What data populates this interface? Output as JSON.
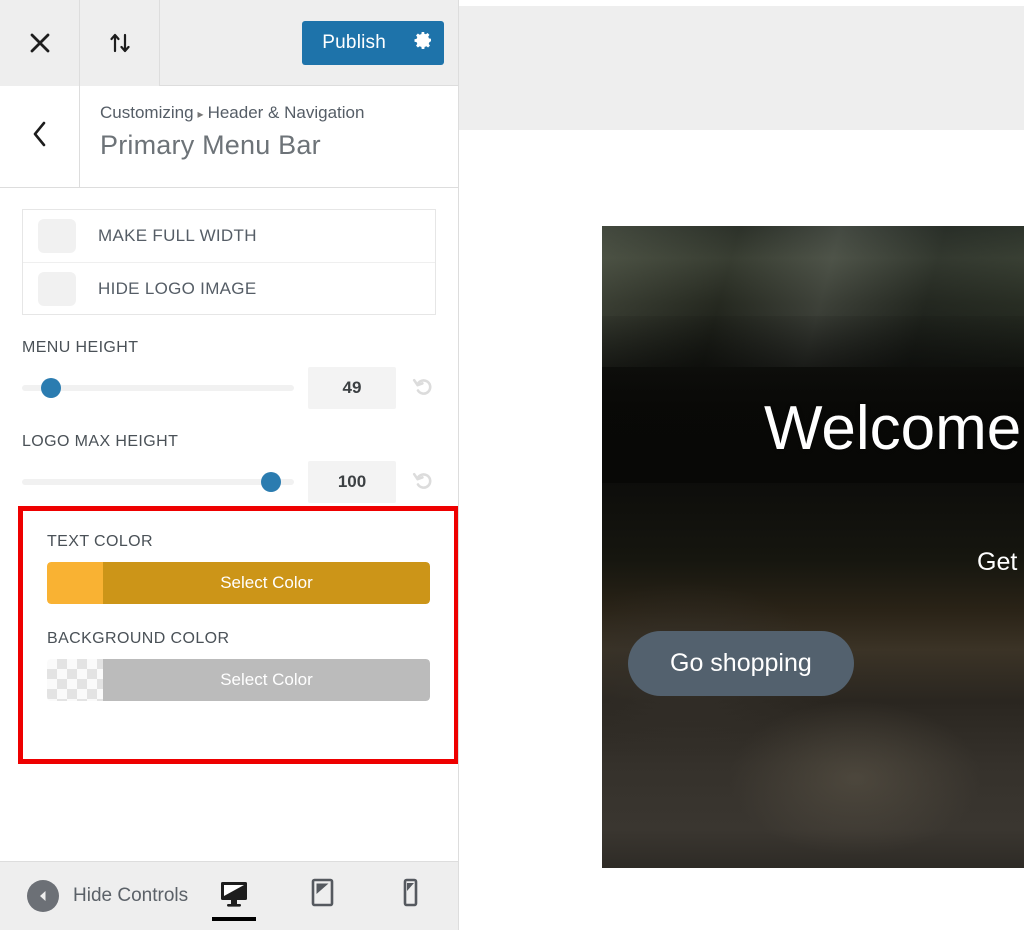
{
  "topbar": {
    "close_icon": "close-x-icon",
    "collapse_icon": "sort-arrows-icon",
    "publish_label": "Publish",
    "gear_icon": "gear-icon"
  },
  "section_header": {
    "back_icon": "chevron-left-icon",
    "breadcrumb_root": "Customizing",
    "breadcrumb_separator": "▸",
    "breadcrumb_parent": "Header & Navigation",
    "title": "Primary Menu Bar"
  },
  "toggles": [
    {
      "label": "MAKE FULL WIDTH",
      "checked": false
    },
    {
      "label": "HIDE LOGO IMAGE",
      "checked": false
    }
  ],
  "sliders": [
    {
      "label": "MENU HEIGHT",
      "value": "49",
      "percent": 7,
      "reset_icon": "reset-arrow-icon"
    },
    {
      "label": "LOGO MAX HEIGHT",
      "value": "100",
      "percent": 90,
      "reset_icon": "reset-arrow-icon"
    }
  ],
  "color_section": {
    "highlight_color": "#ee0000",
    "controls": [
      {
        "label": "TEXT COLOR",
        "button_label": "Select Color",
        "swatch_color": "#f9b233",
        "button_color": "#cc9518",
        "transparent": false
      },
      {
        "label": "BACKGROUND COLOR",
        "button_label": "Select Color",
        "swatch_color": "transparent",
        "button_color": "#bbbbbb",
        "transparent": true
      }
    ]
  },
  "bottombar": {
    "hide_controls_label": "Hide Controls",
    "hide_icon": "caret-left-circle-icon",
    "devices": [
      {
        "name": "desktop",
        "icon": "desktop-icon",
        "active": true
      },
      {
        "name": "tablet",
        "icon": "tablet-icon",
        "active": false
      },
      {
        "name": "mobile",
        "icon": "mobile-icon",
        "active": false
      }
    ]
  },
  "preview": {
    "hero_heading": "Welcome",
    "hero_subtext": "Get",
    "hero_cta_label": "Go shopping",
    "cta_color": "#53616e"
  }
}
